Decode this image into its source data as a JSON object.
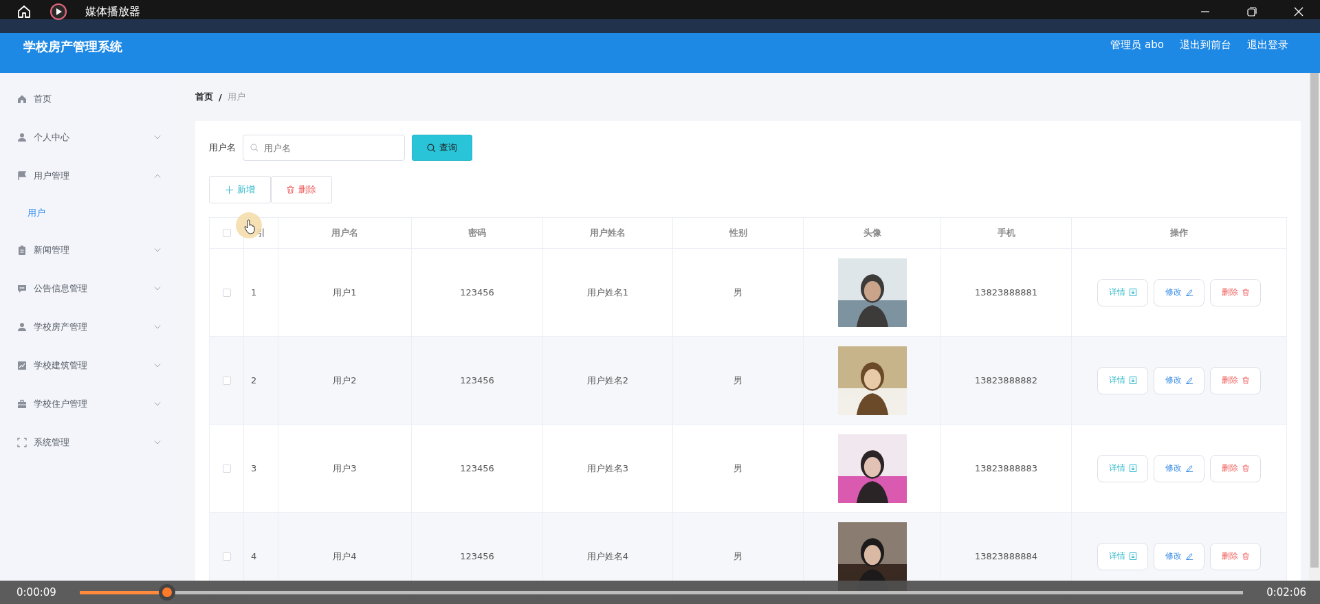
{
  "player": {
    "title": "媒体播放器",
    "elapsed": "0:00:09",
    "duration": "0:02:06",
    "level": 0.075
  },
  "header": {
    "title": "学校房产管理系统",
    "links": [
      "管理员 abo",
      "退出到前台",
      "退出登录"
    ]
  },
  "sidebar": {
    "items": [
      {
        "label": "首页",
        "kind": "link"
      },
      {
        "label": "个人中心",
        "kind": "submenu",
        "expanded": false
      },
      {
        "label": "用户管理",
        "kind": "submenu",
        "expanded": true,
        "children": [
          {
            "label": "用户",
            "selected": true
          }
        ]
      },
      {
        "label": "新闻管理",
        "kind": "submenu",
        "expanded": false
      },
      {
        "label": "公告信息管理",
        "kind": "submenu",
        "expanded": false
      },
      {
        "label": "学校房产管理",
        "kind": "submenu",
        "expanded": false
      },
      {
        "label": "学校建筑管理",
        "kind": "submenu",
        "expanded": false
      },
      {
        "label": "学校住户管理",
        "kind": "submenu",
        "expanded": false
      },
      {
        "label": "系统管理",
        "kind": "submenu",
        "expanded": false
      }
    ]
  },
  "breadcrumb": {
    "items": [
      "首页",
      "用户"
    ],
    "separator": "/"
  },
  "search": {
    "label": "用户名",
    "placeholder": "用户名",
    "button": "查询"
  },
  "toolbar": [
    {
      "label": "新增",
      "kind": "add"
    },
    {
      "label": "删除",
      "kind": "delete"
    }
  ],
  "table": {
    "all_checked": false,
    "columns": [
      "引",
      "用户名",
      "密码",
      "用户姓名",
      "性别",
      "头像",
      "手机",
      "操作"
    ],
    "rows": [
      {
        "checked": false,
        "index": "1",
        "username": "用户1",
        "password": "123456",
        "name": "用户姓名1",
        "gender": "男",
        "avatar": {
          "kind": "picture"
        },
        "phone": "13823888881",
        "actions": [
          "详情",
          "修改",
          "删除"
        ]
      },
      {
        "checked": false,
        "index": "2",
        "username": "用户2",
        "password": "123456",
        "name": "用户姓名2",
        "gender": "男",
        "avatar": {
          "kind": "picture"
        },
        "phone": "13823888882",
        "actions": [
          "详情",
          "修改",
          "删除"
        ]
      },
      {
        "checked": false,
        "index": "3",
        "username": "用户3",
        "password": "123456",
        "name": "用户姓名3",
        "gender": "男",
        "avatar": {
          "kind": "picture"
        },
        "phone": "13823888883",
        "actions": [
          "详情",
          "修改",
          "删除"
        ]
      },
      {
        "checked": false,
        "index": "4",
        "username": "用户4",
        "password": "123456",
        "name": "用户姓名4",
        "gender": "男",
        "avatar": {
          "kind": "picture"
        },
        "phone": "13823888884",
        "actions": [
          "详情",
          "修改",
          "删除"
        ]
      }
    ]
  }
}
